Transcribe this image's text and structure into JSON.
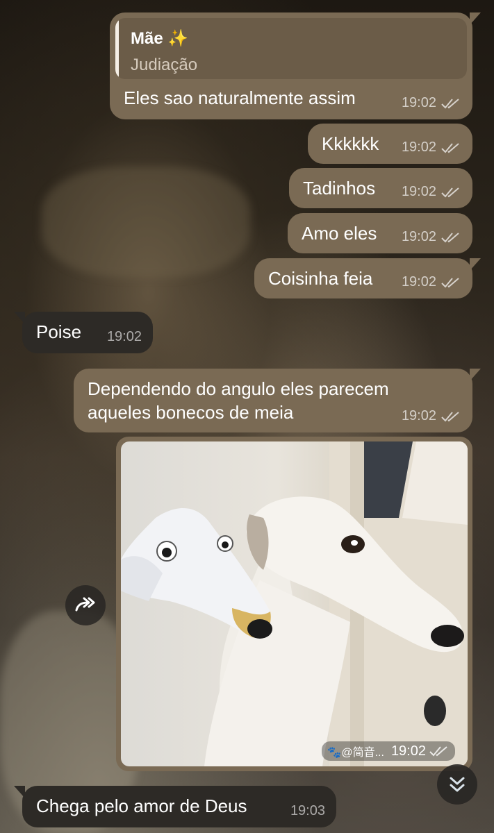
{
  "chat": {
    "messages": [
      {
        "text": "Eles sao naturalmente assim",
        "time": "19:02",
        "reply_name": "Mãe ✨",
        "reply_text": "Judiação"
      },
      {
        "text": "Kkkkkk",
        "time": "19:02"
      },
      {
        "text": "Tadinhos",
        "time": "19:02"
      },
      {
        "text": "Amo eles",
        "time": "19:02"
      },
      {
        "text": "Coisinha feia",
        "time": "19:02"
      },
      {
        "text": "Poise",
        "time": "19:02"
      },
      {
        "text_line1": "Dependendo do angulo eles parecem",
        "text_line2": "aqueles bonecos de meia",
        "time": "19:02"
      },
      {
        "photo_watermark": "🐾@简音...",
        "time": "19:02"
      },
      {
        "text": "Chega pelo amor de Deus",
        "time": "19:03"
      }
    ]
  },
  "colors": {
    "outgoing_bubble": "#7a6a54",
    "incoming_bubble": "#2d2a26",
    "reply_accent": "#f5efe6"
  },
  "icons": {
    "forward": "forward-arrow-icon",
    "scroll_down": "double-chevron-down-icon",
    "read_receipt": "double-check-icon"
  }
}
